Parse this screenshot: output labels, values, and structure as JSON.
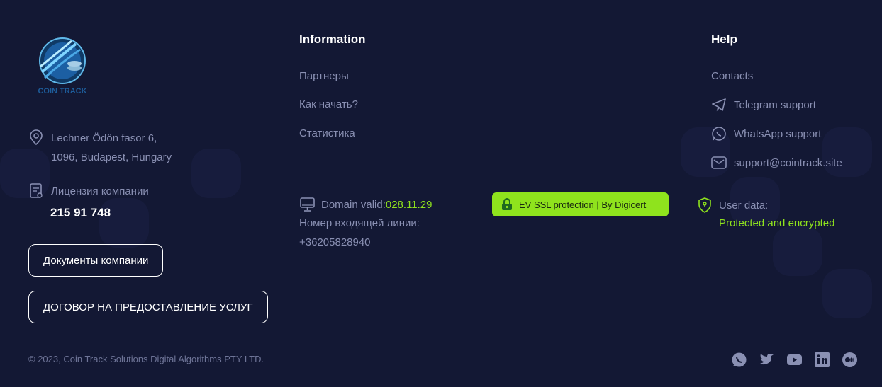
{
  "colors": {
    "background": "#131834",
    "accent": "#8fe31d",
    "text_muted": "#8a90b3",
    "white": "#ffffff"
  },
  "logo": {
    "text": "COIN TRACK"
  },
  "company": {
    "address_line1": "Lechner Ödön fasor 6,",
    "address_line2": "1096, Budapest, Hungary",
    "license_label": "Лицензия компании",
    "license_number": "215 91 748",
    "documents_button": "Документы компании",
    "contract_button": "ДОГОВОР НА ПРЕДОСТАВЛЕНИЕ УСЛУГ",
    "copyright": "© 2023, Coin Track Solutions Digital Algorithms PTY LTD."
  },
  "information": {
    "title": "Information",
    "links": [
      "Партнеры",
      "Как начать?",
      "Статистика"
    ],
    "domain_label": "Domain valid:",
    "domain_value": "028.11.29",
    "incoming_line_label": "Номер входящей линии:",
    "incoming_line_number": "+36205828940"
  },
  "ssl_badge": {
    "label": "EV SSL protection | By Digicert",
    "icon": "lock-icon"
  },
  "help": {
    "title": "Help",
    "contacts": "Contacts",
    "telegram": "Telegram support",
    "whatsapp": "WhatsApp support",
    "email": "support@cointrack.site",
    "user_data_label": "User data:",
    "user_data_value": "Protected and encrypted"
  },
  "socials": [
    "whatsapp-icon",
    "twitter-icon",
    "youtube-icon",
    "linkedin-icon",
    "medium-icon"
  ]
}
